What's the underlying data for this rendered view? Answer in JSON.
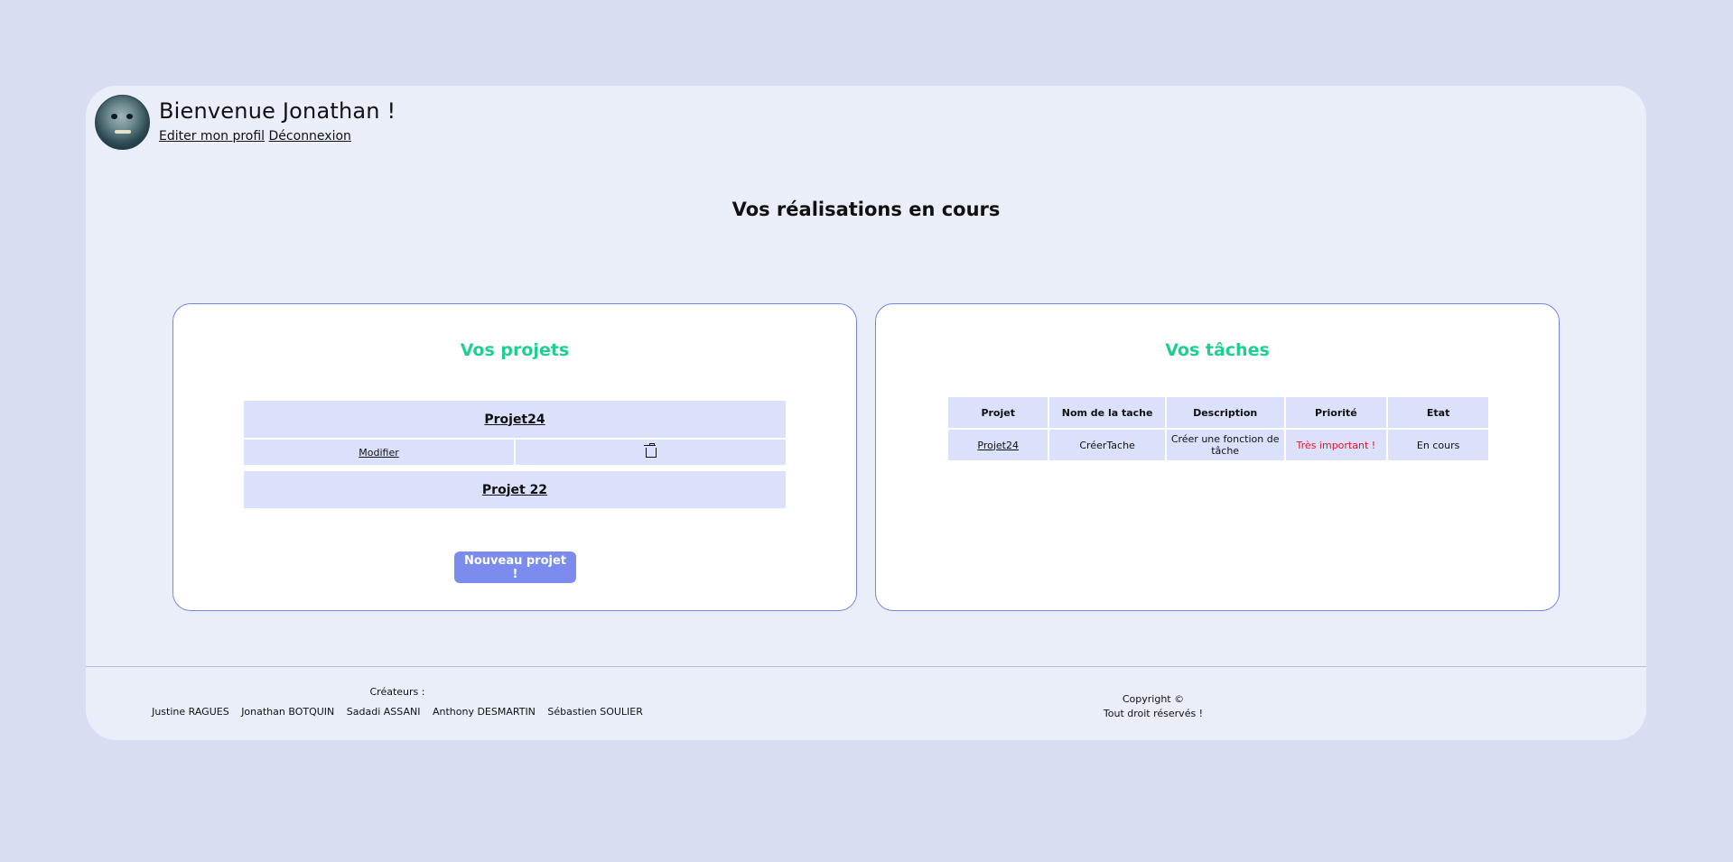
{
  "header": {
    "greeting": "Bienvenue Jonathan !",
    "edit_profile": "Editer mon profil",
    "logout": "Déconnexion"
  },
  "main_title": "Vos réalisations en cours",
  "projects": {
    "title": "Vos projets",
    "items": [
      {
        "name": "Projet24",
        "modify_label": "Modifier",
        "delete_icon": "trash-icon"
      },
      {
        "name": "Projet 22"
      }
    ],
    "new_button": "Nouveau projet !"
  },
  "tasks": {
    "title": "Vos tâches",
    "headers": [
      "Projet",
      "Nom de la tache",
      "Description",
      "Priorité",
      "Etat"
    ],
    "rows": [
      {
        "project": "Projet24",
        "name": "CréerTache",
        "description": "Créer une fonction de tâche",
        "priority": "Très important !",
        "status": "En cours"
      }
    ],
    "priority_color": "#e0192b"
  },
  "footer": {
    "creators_label": "Créateurs :",
    "creators": [
      "Justine RAGUES",
      "Jonathan BOTQUIN",
      "Sadadi ASSANI",
      "Anthony DESMARTIN",
      "Sébastien SOULIER"
    ],
    "copyright_line1": "Copyright ©",
    "copyright_line2": "Tout droit réservés !"
  },
  "colors": {
    "page_bg": "#d8ddf1",
    "panel_bg": "#eaeef9",
    "accent_green": "#1fcf8f",
    "button_blue": "#7b8cee",
    "cell_bg": "#dbe0fb"
  }
}
